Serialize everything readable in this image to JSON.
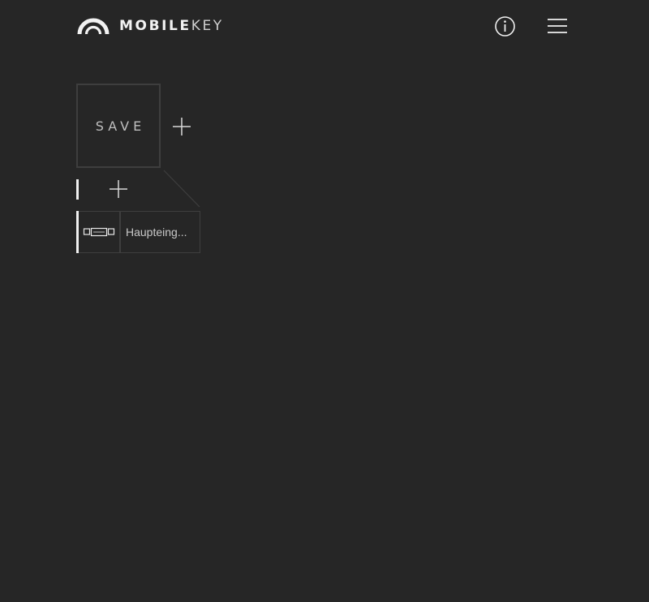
{
  "header": {
    "logo_text_thin": "MOBILE",
    "logo_text_bold": "KEY",
    "logo_icon": "arch-logo-icon",
    "info_icon": "info-icon",
    "menu_icon": "hamburger-menu-icon"
  },
  "main": {
    "save_tile_label": "SAVE",
    "add_tile_icon": "plus-icon",
    "add_device_icon": "plus-icon",
    "devices": [
      {
        "icon": "door-lock-device-icon",
        "name": "Haupteing..."
      }
    ]
  },
  "colors": {
    "background": "#262626",
    "tile_border": "#3e3e3e",
    "text": "#c8c8c8",
    "accent_marker": "#f0f0f0"
  }
}
